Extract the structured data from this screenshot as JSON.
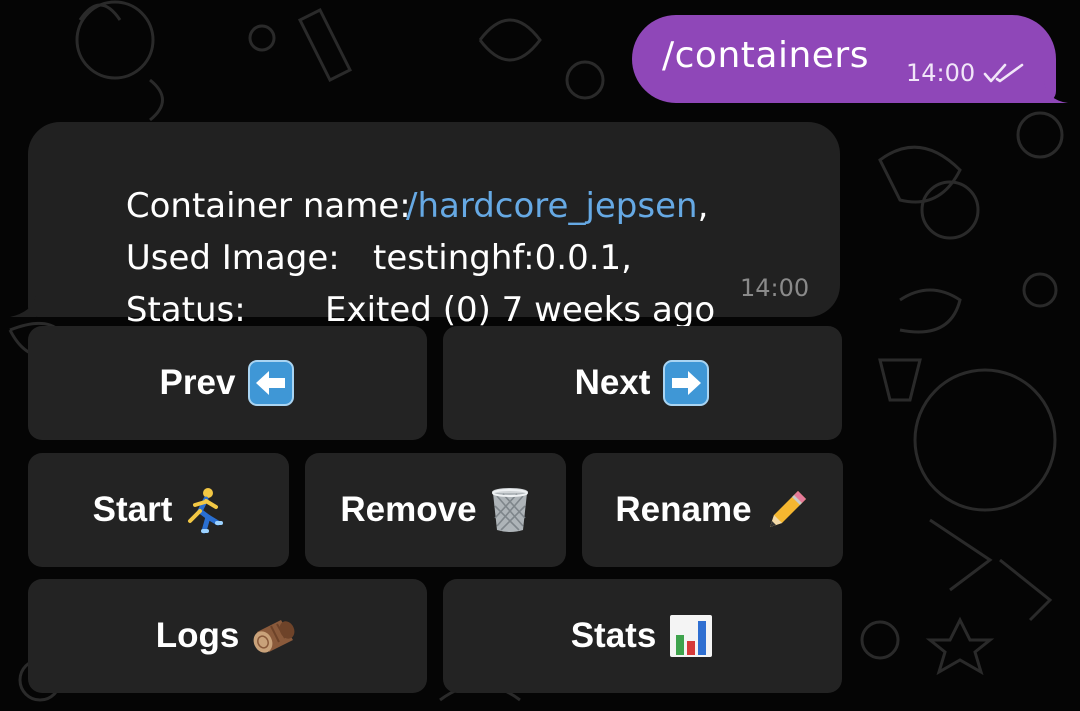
{
  "outgoing": {
    "text": "/containers",
    "time": "14:00",
    "status": "read"
  },
  "incoming": {
    "lines": [
      {
        "label": "Container name:",
        "value": "/hardcore_jepsen",
        "value_suffix": ","
      },
      {
        "label": "Used Image:",
        "value": "testinghf:0.0.1,"
      },
      {
        "label": "Status:",
        "value": "Exited (0) 7 weeks ago"
      }
    ],
    "time": "14:00"
  },
  "keyboard": {
    "prev": {
      "label": "Prev",
      "icon": "left-arrow-icon"
    },
    "next": {
      "label": "Next",
      "icon": "right-arrow-icon"
    },
    "start": {
      "label": "Start",
      "icon": "runner-icon"
    },
    "remove": {
      "label": "Remove",
      "icon": "trash-can-icon"
    },
    "rename": {
      "label": "Rename",
      "icon": "pencil-icon"
    },
    "logs": {
      "label": "Logs",
      "icon": "wood-log-icon"
    },
    "stats": {
      "label": "Stats",
      "icon": "bar-chart-icon"
    }
  },
  "colors": {
    "background": "#050505",
    "outgoing_bubble": "#8f47b8",
    "incoming_bubble": "#212121",
    "link": "#66a9e4",
    "button": "#232323"
  }
}
